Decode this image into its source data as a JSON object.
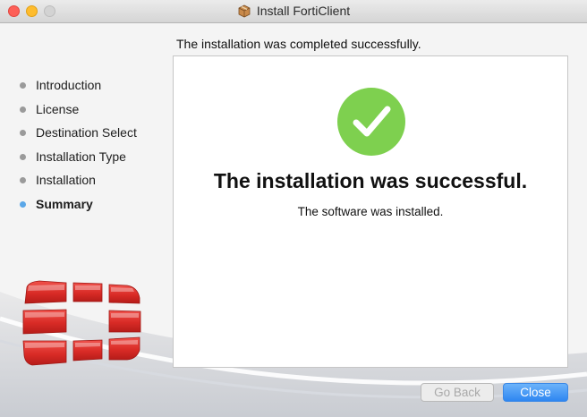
{
  "window": {
    "title": "Install FortiClient",
    "traffic_lights": {
      "close": "#fd5f57",
      "minimize": "#febc2e",
      "zoom": "#d3d3d3"
    }
  },
  "sidebar": {
    "steps": [
      {
        "label": "Introduction",
        "active": false
      },
      {
        "label": "License",
        "active": false
      },
      {
        "label": "Destination Select",
        "active": false
      },
      {
        "label": "Installation Type",
        "active": false
      },
      {
        "label": "Installation",
        "active": false
      },
      {
        "label": "Summary",
        "active": true
      }
    ],
    "active_dot_color": "#5aa7e8",
    "inactive_dot_color": "#9a9a9a"
  },
  "main": {
    "heading": "The installation was completed successfully.",
    "success_title": "The installation was successful.",
    "success_subtitle": "The software was installed.",
    "check_icon": "checkmark-circle-icon",
    "check_color": "#7ed04f"
  },
  "buttons": {
    "back_label": "Go Back",
    "close_label": "Close"
  },
  "brand": {
    "logo": "fortinet-logo",
    "logo_color": "#d9302c"
  }
}
